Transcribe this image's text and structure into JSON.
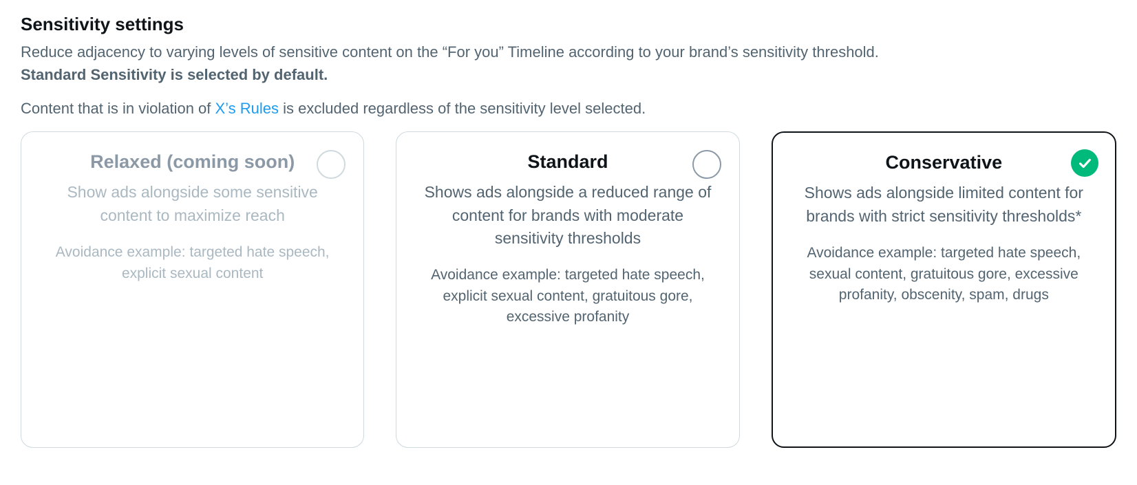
{
  "header": {
    "title": "Sensitivity settings",
    "intro": "Reduce adjacency to varying levels of sensitive content on the “For you” Timeline according to your brand’s sensitivity threshold.",
    "intro_bold": "Standard Sensitivity is selected by default.",
    "rules_prefix": "Content that is in violation of ",
    "rules_link": "X’s Rules",
    "rules_suffix": " is excluded regardless of the sensitivity level selected."
  },
  "options": {
    "relaxed": {
      "title": "Relaxed (coming soon)",
      "description": "Show ads alongside some sensitive content to maximize reach",
      "example": "Avoidance example: targeted hate speech, explicit sexual content",
      "disabled": true,
      "selected": false
    },
    "standard": {
      "title": "Standard",
      "description": "Shows ads alongside a reduced range of content for brands with moderate sensitivity thresholds",
      "example": "Avoidance example: targeted hate speech, explicit sexual content, gratuitous gore, excessive profanity",
      "disabled": false,
      "selected": false
    },
    "conservative": {
      "title": "Conservative",
      "description": "Shows ads alongside limited content for brands with strict sensitivity thresholds*",
      "example": "Avoidance example: targeted hate speech, sexual content, gratuitous gore, excessive profanity, obscenity, spam, drugs",
      "disabled": false,
      "selected": true
    }
  }
}
